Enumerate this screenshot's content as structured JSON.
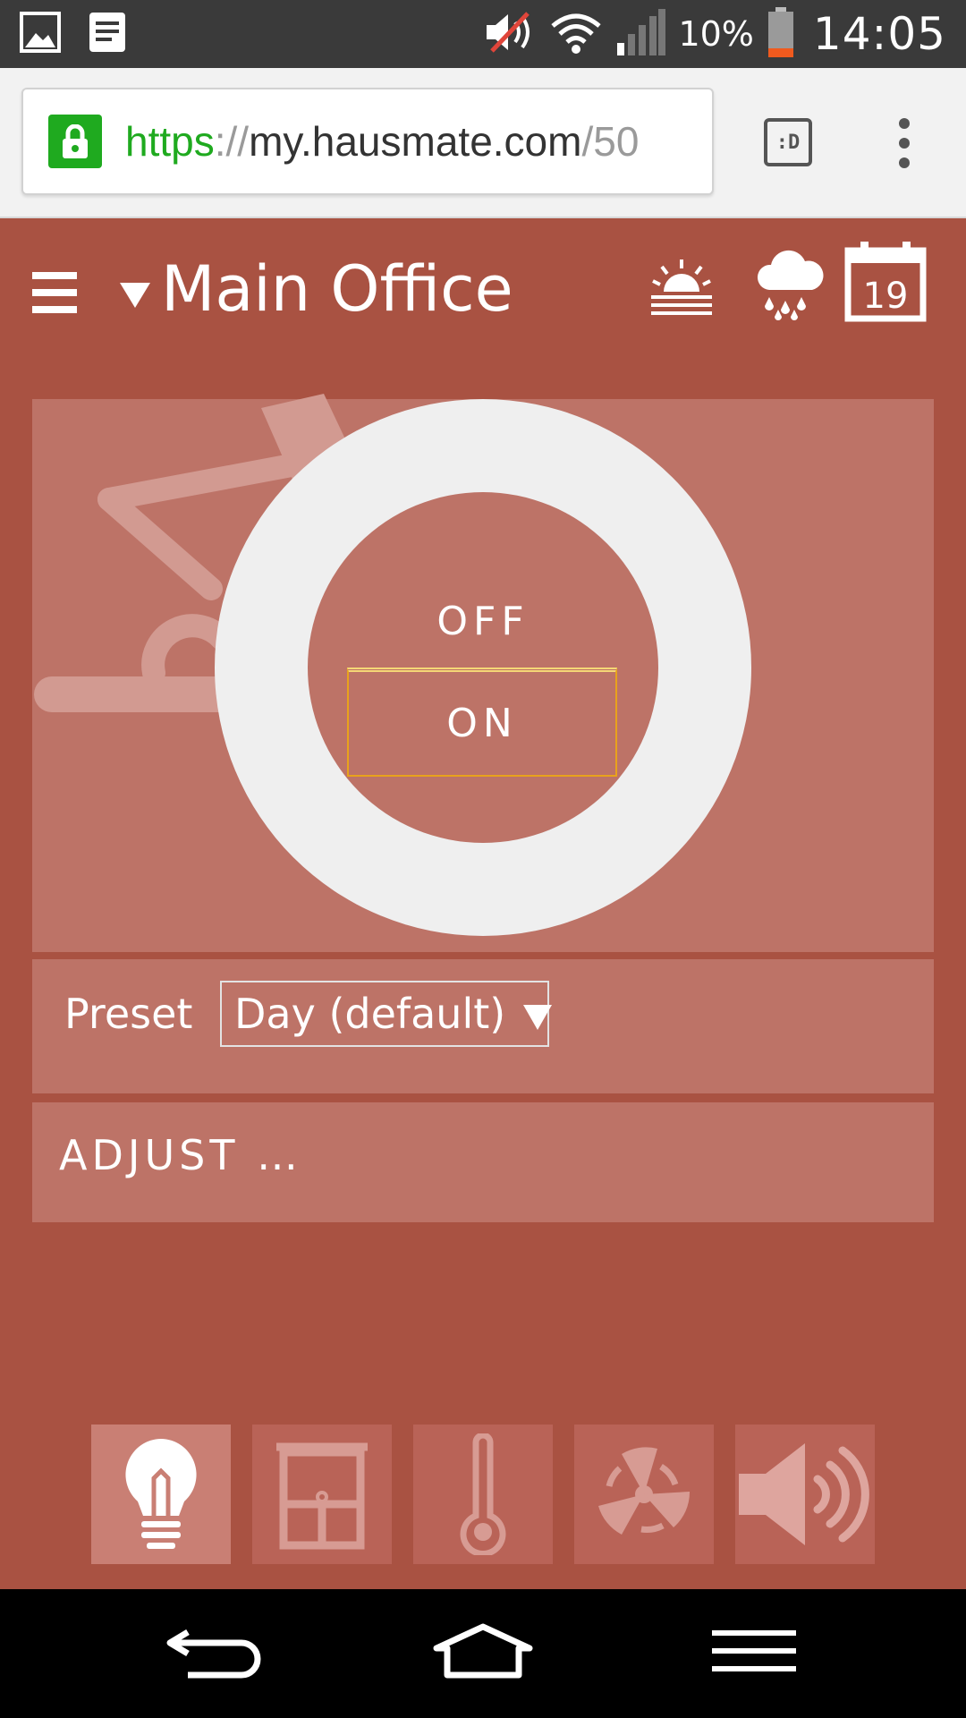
{
  "status_bar": {
    "battery_percent": "10%",
    "clock": "14:05",
    "notification_icons": [
      "gallery-icon",
      "notes-icon"
    ],
    "system_icons": [
      "volume-muted-icon",
      "wifi-icon",
      "signal-icon",
      "battery-icon"
    ]
  },
  "browser": {
    "url_scheme": "https",
    "url_separator": "://",
    "url_host": "my.hausmate.com",
    "url_path": "/50",
    "tab_switcher_label": ":D",
    "secure": true
  },
  "header": {
    "room_title": "Main Office",
    "icons": [
      "sunrise-icon",
      "rain-cloud-icon",
      "calendar-icon"
    ],
    "calendar_day": "19"
  },
  "light_control": {
    "off_label": "OFF",
    "on_label": "ON"
  },
  "preset": {
    "label": "Preset",
    "selected": "Day (default)"
  },
  "adjust": {
    "label": "ADJUST …"
  },
  "categories": [
    {
      "name": "light",
      "icon": "lightbulb-icon",
      "active": true
    },
    {
      "name": "blinds",
      "icon": "window-blinds-icon",
      "active": false
    },
    {
      "name": "temperature",
      "icon": "thermometer-icon",
      "active": false
    },
    {
      "name": "ventilation",
      "icon": "fan-icon",
      "active": false
    },
    {
      "name": "audio",
      "icon": "speaker-icon",
      "active": false
    }
  ],
  "colors": {
    "background": "#a95242",
    "card": "#bd7367",
    "dial": "#efefef",
    "focus_outline": "#e8a21c",
    "secure_green": "#1faa1f"
  }
}
